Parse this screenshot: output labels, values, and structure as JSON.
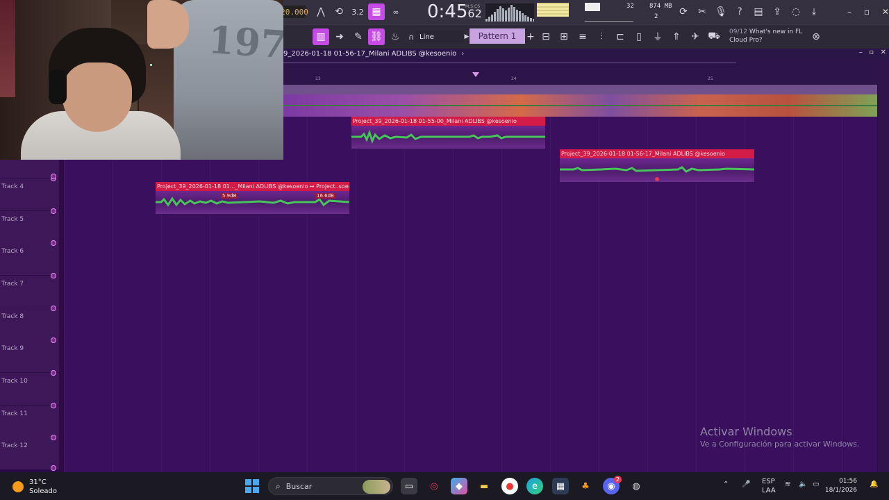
{
  "toolbar": {
    "tempo": "20.000",
    "time": "0:45",
    "time_ms": "62",
    "time_unit": "M:S:CS",
    "cpu": "32",
    "memory": "874 MB",
    "polyphony": "2",
    "snap_mode": "Line",
    "pattern": "Pattern 1",
    "news_num": "09/12",
    "news_text": "What's new in FL Cloud Pro?"
  },
  "playlist": {
    "title": "9_2026-01-18 01-56-17_Milani ADLIBS @kesoenio",
    "ruler_ticks": [
      "23",
      "24",
      "25"
    ],
    "tracks": [
      "Track 4",
      "Track 5",
      "Track 6",
      "Track 7",
      "Track 8",
      "Track 9",
      "Track 10",
      "Track 11",
      "Track 12"
    ]
  },
  "clips": [
    {
      "label": "Project_39_2026-01-18 01-55-00_Milani ADLIBS @kesoenio"
    },
    {
      "label": "Project_39_2026-01-18 01-56-17_Milani ADLIBS @kesoenio"
    },
    {
      "label": "Project_39_2026-01-18 01..._Milani ADLIBS @kesoenio ↦ Project..soenio",
      "db_left": "5.9dB",
      "db_right": "16.6dB"
    }
  ],
  "watermark": {
    "title": "Activar Windows",
    "subtitle": "Ve a Configuración para activar Windows."
  },
  "taskbar": {
    "temperature": "31°C",
    "weather": "Soleado",
    "search_placeholder": "Buscar",
    "lang": "ESP",
    "lang2": "LAA",
    "time": "01:56",
    "date": "18/1/2026",
    "discord_badge": "2"
  },
  "colors": {
    "accent": "#c44be3",
    "clip_header": "#d21c47",
    "playlist_bg": "#3a0f5e"
  }
}
